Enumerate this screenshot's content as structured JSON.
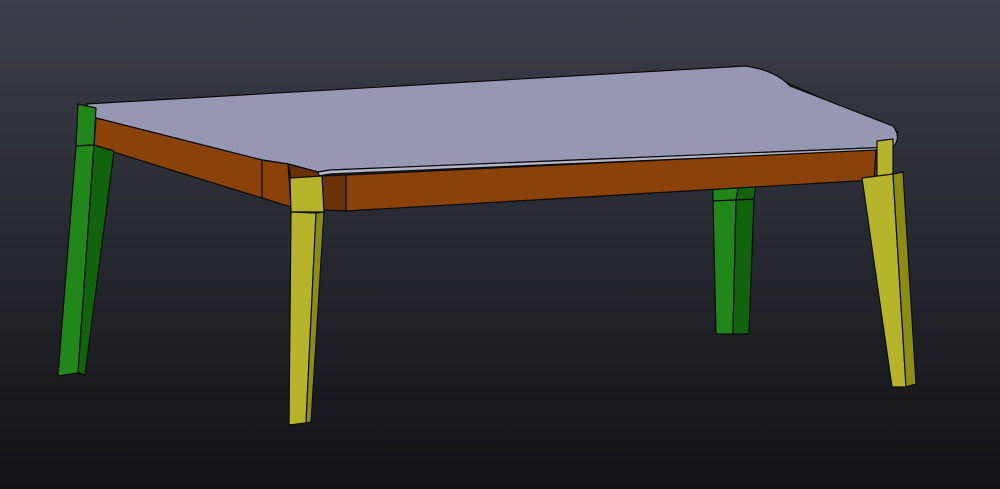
{
  "viewport": {
    "background": {
      "top": "#3b3f49",
      "bottom": "#111216"
    }
  },
  "model": {
    "colors": {
      "tabletop": "#9597b3",
      "tabletop_edge": "#b3b5c8",
      "apron_front": "#8a4208",
      "apron_front_shadow": "#6a3206",
      "apron_right": "#7a3c08",
      "leg_yellow_light": "#b5b42a",
      "leg_yellow_dark": "#8c8c14",
      "leg_green_light": "#22871a",
      "leg_green_dark": "#11630d"
    }
  }
}
